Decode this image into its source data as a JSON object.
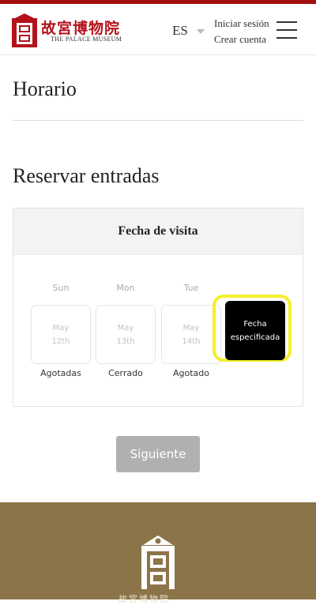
{
  "brand": {
    "name_cn": "故宮博物院",
    "name_en": "THE PALACE MUSEUM",
    "accent": "#a50f10"
  },
  "header": {
    "language": "ES",
    "login": "Iniciar sesión",
    "signup": "Crear cuenta"
  },
  "sections": {
    "schedule_title": "Horario",
    "booking_title": "Reservar entradas"
  },
  "visit_panel": {
    "title": "Fecha de visita",
    "days": [
      {
        "dow": "Sun",
        "month": "May",
        "day": "12th",
        "status": "Agotadas"
      },
      {
        "dow": "Mon",
        "month": "May",
        "day": "13th",
        "status": "Cerrado"
      },
      {
        "dow": "Tue",
        "month": "May",
        "day": "14th",
        "status": "Agotado"
      }
    ],
    "specified": {
      "line1": "Fecha",
      "line2": "especificada"
    }
  },
  "actions": {
    "next": "Siguiente"
  },
  "footer": {
    "bg_color": "#8c7449",
    "text": "故宮博物院"
  }
}
